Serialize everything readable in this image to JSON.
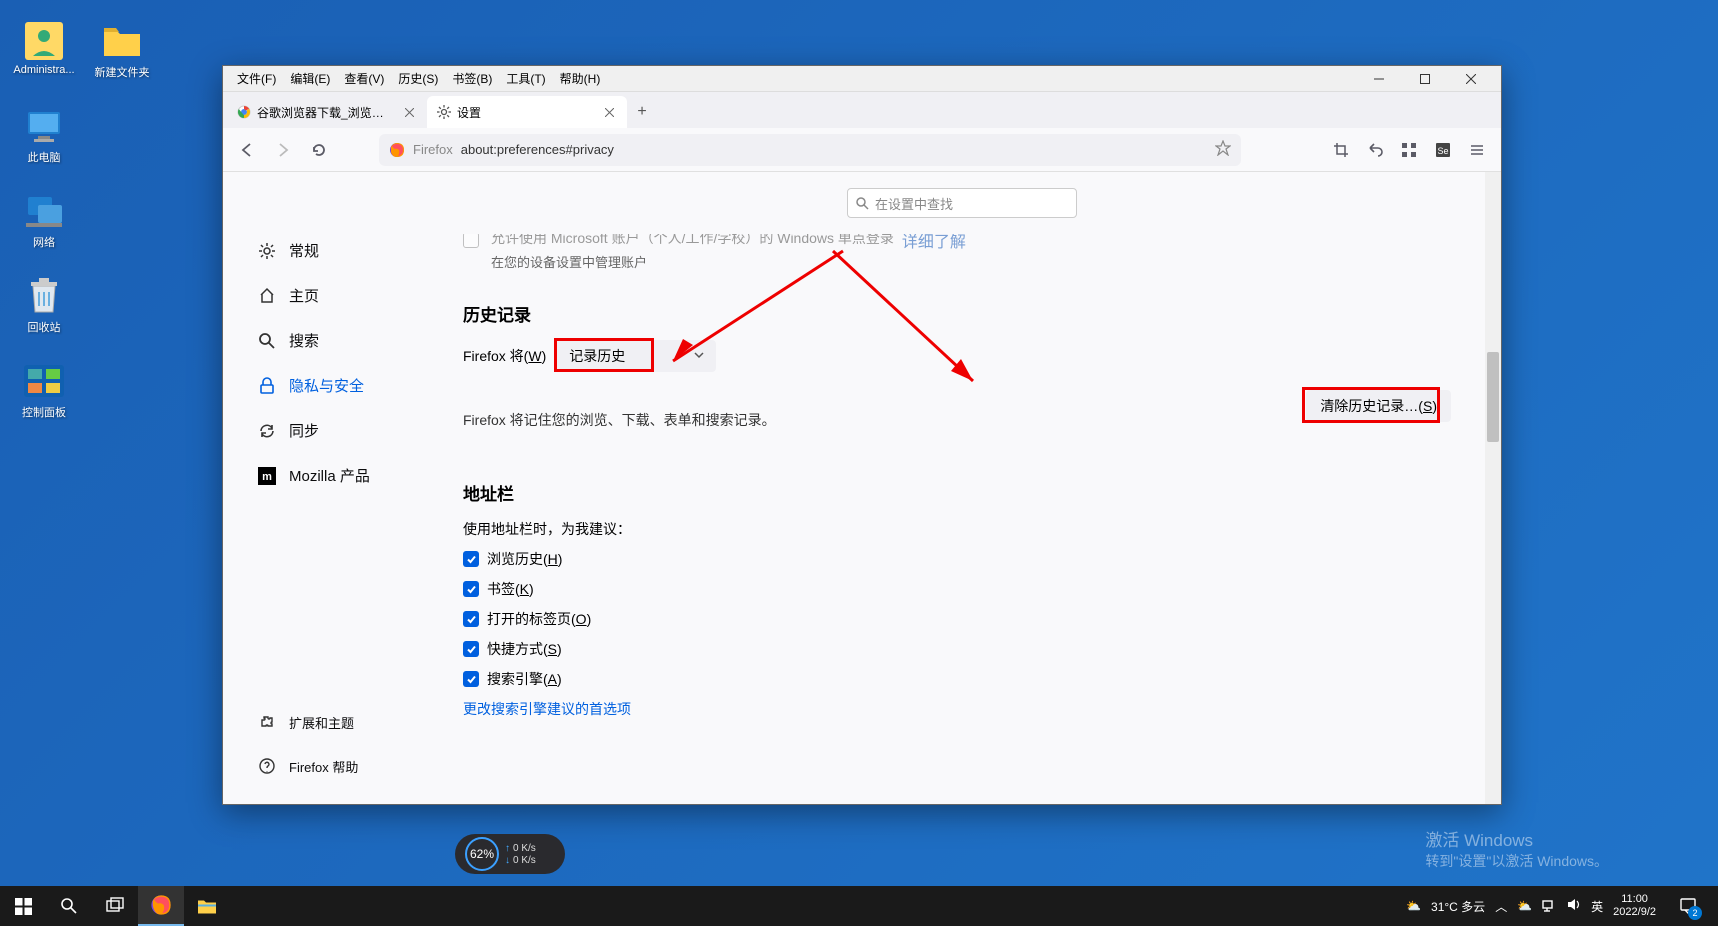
{
  "desktop": {
    "icons": [
      "Administra...",
      "新建文件夹",
      "此电脑",
      "网络",
      "回收站",
      "控制面板"
    ]
  },
  "menubar": {
    "file": "文件(F)",
    "edit": "编辑(E)",
    "view": "查看(V)",
    "history": "历史(S)",
    "bookmarks": "书签(B)",
    "tools": "工具(T)",
    "help": "帮助(H)"
  },
  "tabs": {
    "t1": "谷歌浏览器下载_浏览器官网入口",
    "t2": "设置"
  },
  "addressbar": {
    "prefix": "Firefox",
    "url": "about:preferences#privacy"
  },
  "sidebar": {
    "general": "常规",
    "home": "主页",
    "search": "搜索",
    "privacy": "隐私与安全",
    "sync": "同步",
    "mozilla": "Mozilla 产品",
    "ext": "扩展和主题",
    "help": "Firefox 帮助"
  },
  "search_placeholder": "在设置中查找",
  "top_cut": {
    "line": "允许使用 Microsoft 账户（个人/工作/学校）的 Windows 单点登录",
    "link": "详细了解",
    "sub": "在您的设备设置中管理账户"
  },
  "history": {
    "title": "历史记录",
    "label": "Firefox 将(W)",
    "dropdown": "记录历史",
    "desc": "Firefox 将记住您的浏览、下载、表单和搜索记录。",
    "clear": "清除历史记录…(S)"
  },
  "addressbar_section": {
    "title": "地址栏",
    "sub": "使用地址栏时，为我建议：",
    "opts": [
      "浏览历史(H)",
      "书签(K)",
      "打开的标签页(O)",
      "快捷方式(S)",
      "搜索引擎(A)"
    ],
    "link": "更改搜索引擎建议的首选项"
  },
  "watermark": {
    "t": "激活 Windows",
    "s": "转到\"设置\"以激活 Windows。"
  },
  "taskbar": {
    "weather": "31°C  多云",
    "ime": "英",
    "time": "11:00",
    "date": "2022/9/2",
    "notif_count": "2"
  },
  "net": {
    "pct": "62%",
    "up": "0 K/s",
    "down": "0 K/s"
  }
}
